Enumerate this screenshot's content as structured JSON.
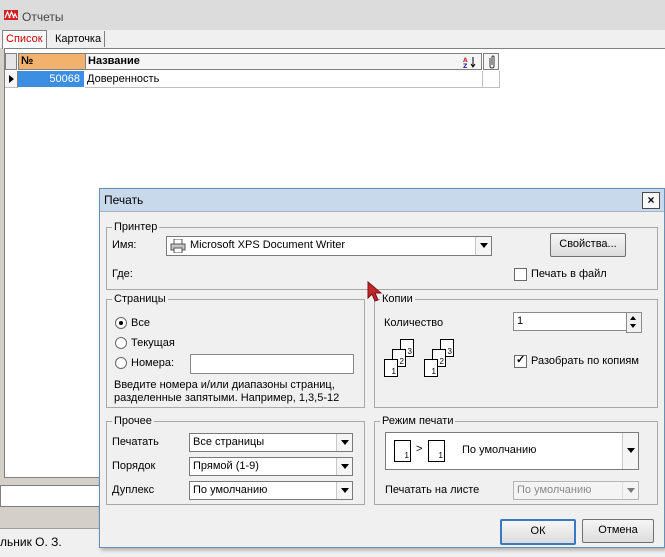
{
  "main": {
    "title": "Отчеты",
    "tabs": [
      {
        "label": "Список"
      },
      {
        "label": "Карточка"
      }
    ],
    "grid": {
      "headers": {
        "num": "№",
        "name": "Название"
      },
      "rows": [
        {
          "num": "50068",
          "name": "Доверенность"
        }
      ]
    },
    "status": "льник О. З."
  },
  "dialog": {
    "title": "Печать",
    "close_glyph": "×",
    "printer": {
      "legend": "Принтер",
      "name_label": "Имя:",
      "name_value": "Microsoft XPS Document Writer",
      "where_label": "Где:",
      "properties_button": "Свойства...",
      "print_to_file_label": "Печать в файл",
      "print_to_file_checked": false
    },
    "pages": {
      "legend": "Страницы",
      "options": [
        {
          "label": "Все",
          "selected": true
        },
        {
          "label": "Текущая",
          "selected": false
        },
        {
          "label": "Номера:",
          "selected": false
        }
      ],
      "numbers_value": "",
      "hint_line1": "Введите номера и/или диапазоны страниц,",
      "hint_line2": "разделенные запятыми. Например, 1,3,5-12"
    },
    "copies": {
      "legend": "Копии",
      "count_label": "Количество",
      "count_value": "1",
      "collate_label": "Разобрать по копиям",
      "collate_checked": true
    },
    "other": {
      "legend": "Прочее",
      "print_label": "Печатать",
      "print_value": "Все страницы",
      "order_label": "Порядок",
      "order_value": "Прямой (1-9)",
      "duplex_label": "Дуплекс",
      "duplex_value": "По умолчанию"
    },
    "mode": {
      "legend": "Режим печати",
      "mode_value": "По умолчанию",
      "sheet_label": "Печатать на листе",
      "sheet_value": "По умолчанию"
    },
    "ok_button": "ОК",
    "cancel_button": "Отмена"
  },
  "colors": {
    "accent_tab": "#c00000",
    "selection": "#3c8ee2",
    "header_sort": "#f2b26e",
    "cursor": "#c0282a"
  }
}
